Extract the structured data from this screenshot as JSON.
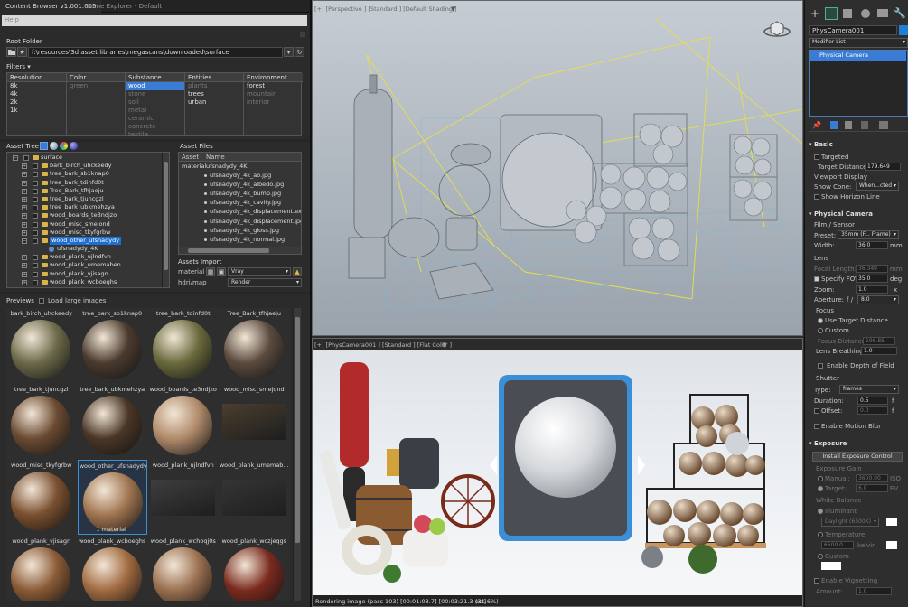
{
  "tabs": [
    "Content Browser v1.001.005",
    "Scene Explorer - Default"
  ],
  "help": "Help",
  "root_folder": {
    "label": "Root Folder",
    "path": "f:\\resources\\3d asset libraries\\megascans\\downloaded\\surface"
  },
  "filters": {
    "label": "Filters",
    "columns": [
      {
        "header": "Resolution",
        "items": [
          "8k",
          "4k",
          "2k",
          "1k"
        ],
        "dim": [],
        "selected": -1
      },
      {
        "header": "Color",
        "items": [
          "green"
        ],
        "dim": [
          0
        ],
        "selected": -1
      },
      {
        "header": "Substance",
        "items": [
          "wood",
          "stone",
          "soil",
          "metal",
          "ceramic",
          "concrete",
          "textile"
        ],
        "dim": [
          1,
          2,
          3,
          4,
          5,
          6
        ],
        "selected": 0
      },
      {
        "header": "Entities",
        "items": [
          "plants",
          "trees",
          "urban"
        ],
        "dim": [
          0
        ],
        "selected": -1
      },
      {
        "header": "Environment",
        "items": [
          "forest",
          "mountain",
          "interior"
        ],
        "dim": [
          1,
          2
        ],
        "selected": -1
      }
    ]
  },
  "asset_tree": {
    "label": "Asset Tree",
    "root": "surface",
    "items": [
      "bark_birch_uhckeedy",
      "tree_bark_sb1knap0",
      "tree_bark_tdinfd0t",
      "Tree_Bark_tfhjaeju",
      "tree_bark_tjuncgzl",
      "tree_bark_ubkmehzya",
      "wood_boards_te3ndjzo",
      "wood_misc_smejond",
      "wood_misc_tkyfgrbw",
      "wood_other_ufsnadydy",
      "ufsnadydy_4K",
      "wood_plank_ujlndfvn",
      "wood_plank_umemaben",
      "wood_plank_vjisagn",
      "wood_plank_wcboeghs"
    ],
    "selected": 9
  },
  "asset_files": {
    "label": "Asset Files",
    "col_asset": "Asset",
    "col_name": "Name",
    "material_label": "material",
    "material_name": "ufsnadydy_4K",
    "files": [
      "ufsnadydy_4k_ao.jpg",
      "ufsnadydy_4k_albedo.jpg",
      "ufsnadydy_4k_bump.jpg",
      "ufsnadydy_4k_cavity.jpg",
      "ufsnadydy_4k_displacement.exr",
      "ufsnadydy_4k_displacement.jpg",
      "ufsnadydy_4k_gloss.jpg",
      "ufsnadydy_4k_normal.jpg"
    ]
  },
  "assets_import": {
    "label": "Assets Import",
    "material_label": "material",
    "material_value": "Vray",
    "hdri_label": "hdri/map",
    "hdri_value": "Render"
  },
  "previews": {
    "label": "Previews",
    "load_large": "Load large images",
    "badge": "1 material",
    "items": [
      {
        "name": "bark_birch_uhckeedy",
        "color": "#6b6a4a"
      },
      {
        "name": "tree_bark_sb1knap0",
        "color": "#4a3a2e"
      },
      {
        "name": "tree_bark_tdinfd0t",
        "color": "#6a6a3e"
      },
      {
        "name": "Tree_Bark_tfhjaeju",
        "color": "#5a4a3e"
      },
      {
        "name": "tree_bark_tjuncgzl",
        "color": "#6a4a32"
      },
      {
        "name": "tree_bark_ubkmehzya",
        "color": "#4a3626"
      },
      {
        "name": "wood_boards_te3ndjzo",
        "color": "#b08a6a"
      },
      {
        "name": "wood_misc_smejond",
        "color": "#4a3e2e"
      },
      {
        "name": "wood_misc_tkyfgrbw",
        "color": "#7a5030"
      },
      {
        "name": "wood_other_ufsnadydy",
        "color": "#a07450"
      },
      {
        "name": "wood_plank_ujlndfvn",
        "color": "#3e3e3e"
      },
      {
        "name": "wood_plank_umemab...",
        "color": "#353535"
      },
      {
        "name": "wood_plank_vjisagn",
        "color": "#8a5a36"
      },
      {
        "name": "wood_plank_wcboeghs",
        "color": "#a06a40"
      },
      {
        "name": "wood_plank_wchoqj0s",
        "color": "#9a7050"
      },
      {
        "name": "wood_plank_wczjeqgs",
        "color": "#7a2a1e"
      }
    ]
  },
  "viewport_top": {
    "label": "[+] [Perspective ] [Standard ] [Default Shading ]"
  },
  "viewport_bottom": {
    "label": "[+] [PhysCamera001 ] [Standard ] [Flat Color ]",
    "status": "Rendering image (pass 103) [00:01:03.7] [00:03:21.3 est]",
    "percent": "(31.6%)"
  },
  "right_panel": {
    "object_name": "PhysCamera001",
    "modifier_list": "Modifier List",
    "stack_item": "Physical Camera",
    "basic": {
      "title": "Basic",
      "targeted": "Targeted",
      "target_distance_label": "Target Distance:",
      "target_distance": "179.649",
      "viewport_display": "Viewport Display",
      "show_cone_label": "Show Cone:",
      "show_cone": "When...cted",
      "show_horizon": "Show Horizon Line"
    },
    "physical_camera": {
      "title": "Physical Camera",
      "film_sensor": "Film / Sensor",
      "preset_label": "Preset:",
      "preset": "35mm (F... Frame)",
      "width_label": "Width:",
      "width": "36.0",
      "width_unit": "mm",
      "lens": "Lens",
      "focal_length_label": "Focal Length:",
      "focal_length": "36.349",
      "focal_length_unit": "mm",
      "specify_fov": "Specify FOV:",
      "fov": "35.0",
      "fov_unit": "deg",
      "zoom_label": "Zoom:",
      "zoom": "1.0",
      "zoom_unit": "x",
      "aperture_label": "Aperture:",
      "aperture_f": "f /",
      "aperture": "8.0",
      "focus": "Focus",
      "use_target_distance": "Use Target Distance",
      "custom": "Custom",
      "focus_distance_label": "Focus Distance:",
      "focus_distance": "196.85",
      "lens_breathing_label": "Lens Breathing:",
      "lens_breathing": "1.0",
      "enable_dof": "Enable Depth of Field",
      "shutter": "Shutter",
      "type_label": "Type:",
      "type": "frames",
      "duration_label": "Duration:",
      "duration": "0.5",
      "duration_unit": "f",
      "offset_label": "Offset:",
      "offset": "0.0",
      "offset_unit": "f",
      "motion_blur": "Enable Motion Blur"
    },
    "exposure": {
      "title": "Exposure",
      "install_btn": "Install Exposure Control",
      "exposure_gain": "Exposure Gain",
      "manual_label": "Manual:",
      "manual": "3600.00",
      "manual_unit": "ISO",
      "target_label": "Target:",
      "target": "6.0",
      "target_unit": "EV",
      "white_balance": "White Balance",
      "illuminant": "Illuminant",
      "illuminant_value": "Daylight (6500K)",
      "temperature": "Temperature",
      "temperature_value": "6500.0",
      "temperature_unit": "kelvin",
      "custom": "Custom",
      "vignetting": "Enable Vignetting",
      "amount_label": "Amount:",
      "amount": "1.0"
    }
  }
}
